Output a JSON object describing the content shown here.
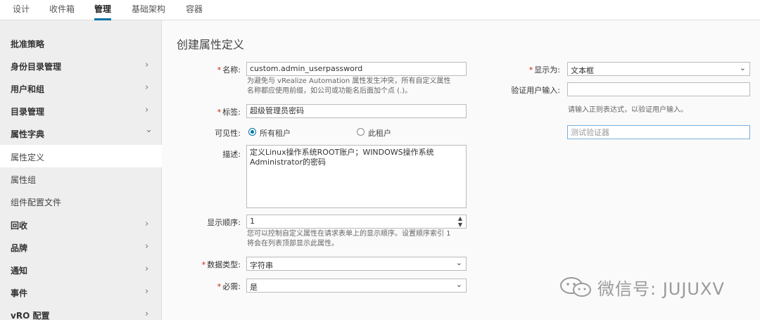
{
  "topnav": {
    "tabs": [
      {
        "label": "设计"
      },
      {
        "label": "收件箱"
      },
      {
        "label": "管理"
      },
      {
        "label": "基础架构"
      },
      {
        "label": "容器"
      }
    ],
    "active": "管理"
  },
  "sidebar": {
    "items": [
      {
        "label": "批准策略",
        "chevron": ""
      },
      {
        "label": "身份目录管理",
        "chevron": "›"
      },
      {
        "label": "用户和组",
        "chevron": "›"
      },
      {
        "label": "目录管理",
        "chevron": "›"
      },
      {
        "label": "属性字典",
        "chevron": "⌄"
      },
      {
        "label": "属性定义",
        "chevron": ""
      },
      {
        "label": "属性组",
        "chevron": ""
      },
      {
        "label": "组件配置文件",
        "chevron": ""
      },
      {
        "label": "回收",
        "chevron": "›"
      },
      {
        "label": "品牌",
        "chevron": "›"
      },
      {
        "label": "通知",
        "chevron": "›"
      },
      {
        "label": "事件",
        "chevron": "›"
      },
      {
        "label": "vRO 配置",
        "chevron": "›"
      }
    ],
    "active": "属性定义"
  },
  "form": {
    "title": "创建属性定义",
    "name": {
      "label": "名称:",
      "value": "custom.admin_userpassword",
      "help_line1": "为避免与 vRealize Automation 属性发生冲突，所有自定义属性",
      "help_line2": "名称都应使用前缀，如公司或功能名后面加个点 (.)。"
    },
    "tag": {
      "label": "标签:",
      "value": "超级管理员密码"
    },
    "visibility": {
      "label": "可见性:",
      "option_all": "所有租户",
      "option_this": "此租户",
      "selected": "所有租户"
    },
    "description": {
      "label": "描述:",
      "line1": "定义Linux操作系统ROOT账户；WINDOWS操作系统",
      "line2": "Administrator的密码"
    },
    "display_order": {
      "label": "显示顺序:",
      "value": "1",
      "help_line1": "您可以控制自定义属性在请求表单上的显示顺序。设置顺序索引 1",
      "help_line2": "将会在列表顶部显示此属性。"
    },
    "data_type": {
      "label": "数据类型:",
      "value": "字符串"
    },
    "required": {
      "label": "必需:",
      "value": "是"
    },
    "display_as": {
      "label": "显示为:",
      "value": "文本框"
    },
    "validate": {
      "label": "验证用户输入:",
      "value": "",
      "help": "请输入正则表达式，以验证用户输入。"
    },
    "test_validator": {
      "placeholder": "测试验证器"
    }
  },
  "watermark": {
    "text": "微信号: JUJUXV"
  },
  "colors": {
    "accent": "#0072a3",
    "required": "#c92100",
    "sidebar_bg": "#eeeeee"
  }
}
